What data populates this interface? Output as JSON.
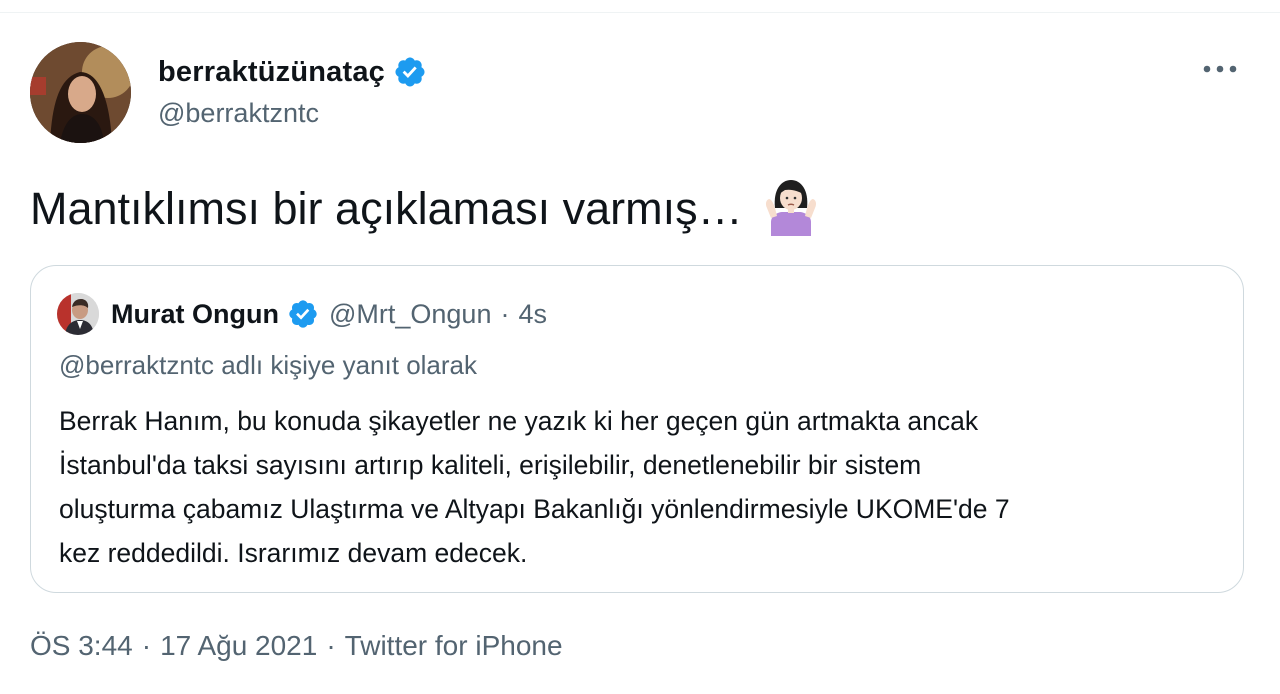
{
  "tweet": {
    "author": {
      "display_name": "berraktüzünataç",
      "handle": "@berraktzntc",
      "verified": true,
      "avatar_icon": "profile-photo"
    },
    "text": "Mantıklımsı bir açıklaması varmış…",
    "emoji": "woman-shrugging-emoji",
    "more_icon": "more-horizontal-icon",
    "quoted": {
      "display_name": "Murat Ongun",
      "handle": "@Mrt_Ongun",
      "separator": "·",
      "time": "4s",
      "verified": true,
      "reply_context": "@berraktzntc adlı kişiye yanıt olarak",
      "body_lines": [
        "Berrak Hanım, bu konuda şikayetler ne yazık ki her geçen gün artmakta ancak",
        "İstanbul'da taksi sayısını artırıp kaliteli, erişilebilir, denetlenebilir bir sistem",
        "oluşturma çabamız Ulaştırma ve Altyapı Bakanlığı yönlendirmesiyle UKOME'de 7",
        "kez reddedildi. Israrımız devam edecek."
      ]
    },
    "meta": {
      "time": "ÖS 3:44",
      "separator": "·",
      "date": "17 Ağu 2021",
      "source": "Twitter for iPhone"
    }
  },
  "colors": {
    "verified_blue": "#1d9bf0",
    "primary_text": "#0f1419",
    "secondary_text": "#536471",
    "border": "#cfd9de"
  }
}
